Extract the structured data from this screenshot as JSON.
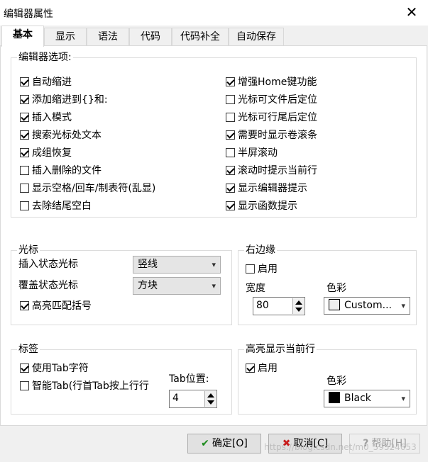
{
  "window": {
    "title": "编辑器属性"
  },
  "tabs": [
    "基本",
    "显示",
    "语法",
    "代码",
    "代码补全",
    "自动保存"
  ],
  "editor_options": {
    "label": "编辑器选项:",
    "left": [
      {
        "label": "自动缩进",
        "checked": true
      },
      {
        "label": "添加缩进到{}和:",
        "checked": true
      },
      {
        "label": "插入模式",
        "checked": true
      },
      {
        "label": "搜索光标处文本",
        "checked": true
      },
      {
        "label": "成组恢复",
        "checked": true
      },
      {
        "label": "插入删除的文件",
        "checked": false
      },
      {
        "label": "显示空格/回车/制表符(乱显)",
        "checked": false
      },
      {
        "label": "去除结尾空白",
        "checked": false
      }
    ],
    "right": [
      {
        "label": "增强Home键功能",
        "checked": true
      },
      {
        "label": "光标可文件后定位",
        "checked": false
      },
      {
        "label": "光标可行尾后定位",
        "checked": false
      },
      {
        "label": "需要时显示卷滚条",
        "checked": true
      },
      {
        "label": "半屏滚动",
        "checked": false
      },
      {
        "label": "滚动时提示当前行",
        "checked": true
      },
      {
        "label": "显示编辑器提示",
        "checked": true
      },
      {
        "label": "显示函数提示",
        "checked": true
      }
    ]
  },
  "cursor": {
    "label": "光标",
    "insert_label": "插入状态光标",
    "insert_value": "竖线",
    "overwrite_label": "覆盖状态光标",
    "overwrite_value": "方块",
    "highlight_brackets": {
      "label": "高亮匹配括号",
      "checked": true
    }
  },
  "right_margin": {
    "label": "右边缘",
    "enabled": {
      "label": "启用",
      "checked": false
    },
    "width_label": "宽度",
    "width_value": "80",
    "color_label": "色彩",
    "color_value": "Custom...",
    "color_swatch": "#f0f0f0"
  },
  "tabs_group": {
    "label": "标签",
    "use_tab": {
      "label": "使用Tab字符",
      "checked": true
    },
    "smart_tab": {
      "label": "智能Tab(行首Tab按上行行",
      "checked": false
    },
    "tab_pos_label": "Tab位置:",
    "tab_pos_value": "4"
  },
  "highlight_line": {
    "label": "高亮显示当前行",
    "enabled": {
      "label": "启用",
      "checked": true
    },
    "color_label": "色彩",
    "color_value": "Black",
    "color_swatch": "#000000"
  },
  "buttons": {
    "ok": "确定[O]",
    "cancel": "取消[C]",
    "help": "帮助[H]"
  },
  "watermark": "https://blog.csdn.net/m0_59524653"
}
